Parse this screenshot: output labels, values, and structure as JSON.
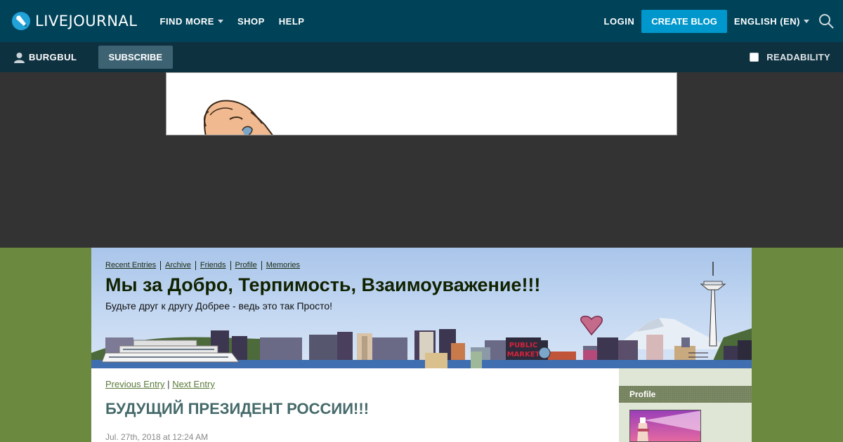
{
  "topbar": {
    "logo_text": "LIVEJOURNAL",
    "nav": [
      {
        "label": "FIND MORE",
        "dropdown": true
      },
      {
        "label": "SHOP",
        "dropdown": false
      },
      {
        "label": "HELP",
        "dropdown": false
      }
    ],
    "login_label": "LOGIN",
    "create_blog_label": "CREATE BLOG",
    "language_label": "ENGLISH (EN)"
  },
  "subbar": {
    "username": "BURGBUL",
    "subscribe_label": "SUBSCRIBE",
    "readability_label": "READABILITY",
    "readability_checked": false
  },
  "journal": {
    "nav_links": [
      "Recent Entries",
      "Archive",
      "Friends",
      "Profile",
      "Memories"
    ],
    "title": "Мы за Добро, Терпимость, Взаимоуважение!!!",
    "subtitle": "Будьте друг к другу Добрее - ведь это так Просто!"
  },
  "entry": {
    "prev_label": "Previous Entry",
    "separator": "|",
    "next_label": "Next Entry",
    "title": "БУДУЩИЙ ПРЕЗИДЕНТ РОССИИ!!!",
    "date": "Jul. 27th, 2018 at 12:24 AM"
  },
  "sidebar": {
    "profile_label": "Profile"
  },
  "colors": {
    "topbar": "#004359",
    "subbar": "#0e3140",
    "create_button": "#0097cc",
    "page_background": "#6c8a3f",
    "entry_title": "#466a6a"
  }
}
